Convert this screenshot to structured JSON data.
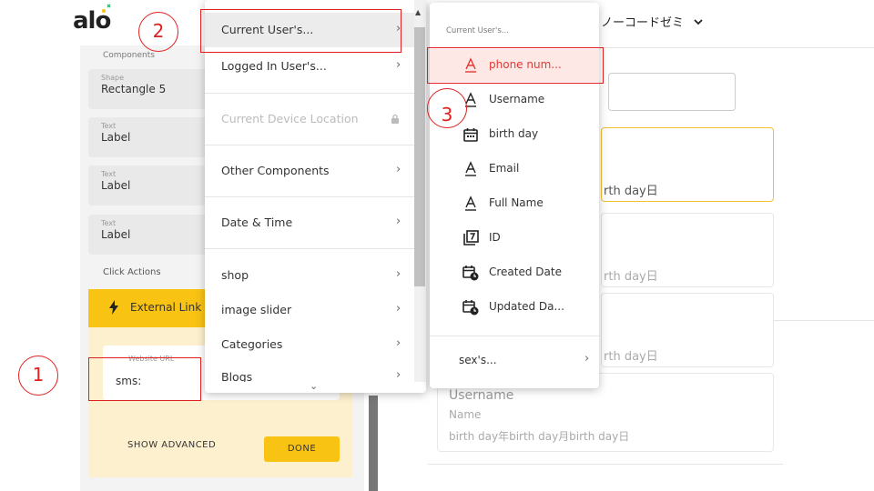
{
  "header": {
    "logo_text": "alo",
    "user_menu_label": "ノーコードゼミ",
    "user_menu_chevron": "chevron-down-icon"
  },
  "left_panel": {
    "components_heading": "Components",
    "components": [
      {
        "type": "Shape",
        "name": "Rectangle 5"
      },
      {
        "type": "Text",
        "name": "Label"
      },
      {
        "type": "Text",
        "name": "Label"
      },
      {
        "type": "Text",
        "name": "Label"
      }
    ],
    "click_actions_heading": "Click Actions",
    "action": {
      "icon": "lightning-bolt-icon",
      "label": "External Link"
    },
    "website_url": {
      "label": "Website URL",
      "value": "sms:"
    },
    "show_advanced_label": "SHOW ADVANCED",
    "done_label": "DONE"
  },
  "menu1": {
    "items": [
      {
        "label": "Current User's...",
        "chevron": true,
        "highlighted": true
      },
      {
        "label": "Logged In User's...",
        "chevron": true
      },
      {
        "label": "Current Device Location",
        "locked": true,
        "disabled": true
      },
      {
        "label": "Other Components",
        "chevron": true
      },
      {
        "label": "Date & Time",
        "chevron": true
      },
      {
        "label": "shop",
        "chevron": true
      },
      {
        "label": "image slider",
        "chevron": true
      },
      {
        "label": "Categories",
        "chevron": true
      },
      {
        "label": "Blogs",
        "chevron": true
      }
    ]
  },
  "menu2": {
    "header": "Current User's...",
    "items": [
      {
        "icon": "text-icon",
        "label": "phone num...",
        "active": true
      },
      {
        "icon": "text-icon",
        "label": "Username"
      },
      {
        "icon": "calendar-icon",
        "label": "birth day"
      },
      {
        "icon": "text-icon",
        "label": "Email"
      },
      {
        "icon": "text-icon",
        "label": "Full Name"
      },
      {
        "icon": "id-icon",
        "label": "ID"
      },
      {
        "icon": "calendar-clock-icon",
        "label": "Created Date"
      },
      {
        "icon": "calendar-clock-icon",
        "label": "Updated Da..."
      }
    ],
    "more_label": "sex's..."
  },
  "right_content": {
    "card_date_fragment": "rth day日",
    "list_card": {
      "title": "Username",
      "subtitle": "Name",
      "date": "birth day年birth day月birth day日"
    }
  },
  "annotations": {
    "one": "1",
    "two": "2",
    "three": "3",
    "color": "#e02020"
  },
  "colors": {
    "accent_yellow": "#f9c313",
    "active_red": "#e53935"
  }
}
